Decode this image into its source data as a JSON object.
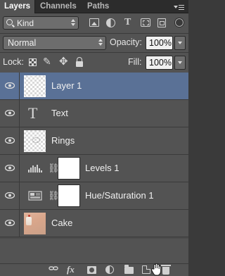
{
  "tabs": [
    {
      "label": "Layers",
      "active": true
    },
    {
      "label": "Channels",
      "active": false
    },
    {
      "label": "Paths",
      "active": false
    }
  ],
  "filter": {
    "kind_label": "Kind",
    "filter_icons": [
      "pixel-layer-filter-icon",
      "adjustment-layer-filter-icon",
      "type-layer-filter-icon",
      "shape-layer-filter-icon",
      "smart-object-filter-icon",
      "filter-toggle-icon"
    ]
  },
  "blend": {
    "mode": "Normal",
    "opacity_label": "Opacity:",
    "opacity_value": "100%"
  },
  "lock": {
    "label": "Lock:",
    "fill_label": "Fill:",
    "fill_value": "100%"
  },
  "layers": [
    {
      "name": "Layer 1",
      "kind": "pixel",
      "selected": true,
      "visible": true
    },
    {
      "name": "Text",
      "kind": "type",
      "selected": false,
      "visible": true
    },
    {
      "name": "Rings",
      "kind": "pixel",
      "selected": false,
      "visible": true
    },
    {
      "name": "Levels 1",
      "kind": "adjustment-levels",
      "selected": false,
      "visible": true
    },
    {
      "name": "Hue/Saturation 1",
      "kind": "adjustment-hue-saturation",
      "selected": false,
      "visible": true
    },
    {
      "name": "Cake",
      "kind": "pixel",
      "selected": false,
      "visible": true
    }
  ],
  "colors": {
    "panel": "#535353",
    "selected_row": "#5a7196",
    "tab_bar": "#2c2c2c"
  },
  "bottom_icons": [
    "link-layers-icon",
    "fx-icon",
    "add-mask-icon",
    "new-adjustment-icon",
    "new-group-icon",
    "new-layer-icon",
    "delete-layer-icon"
  ]
}
